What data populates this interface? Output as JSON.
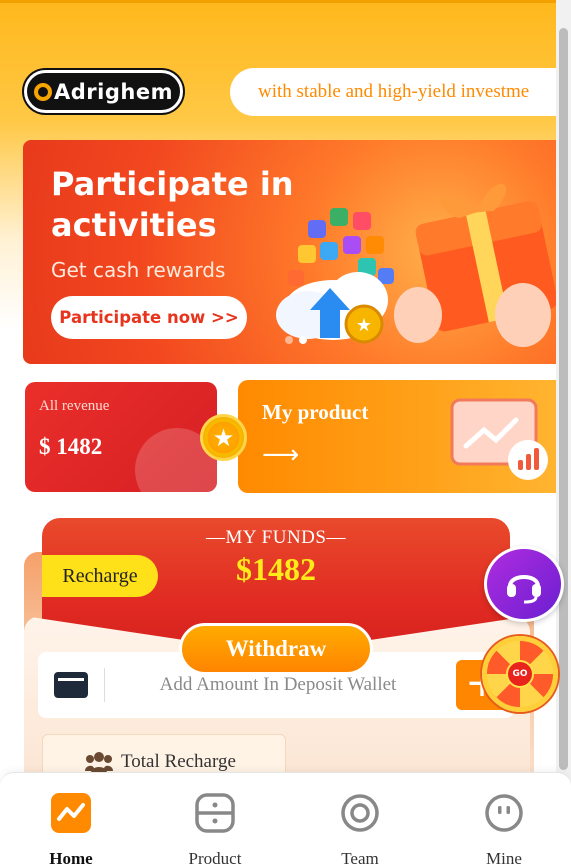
{
  "brand": {
    "logo_text": "Adrighem"
  },
  "marquee": {
    "text": "with stable and high-yield investme"
  },
  "banner": {
    "title": "Participate in activities",
    "subtitle": "Get cash rewards",
    "button_label": "Participate now >>"
  },
  "revenue": {
    "label": "All revenue",
    "value": "$ 1482"
  },
  "my_product": {
    "label": "My product",
    "arrow": "⟶"
  },
  "funds": {
    "label": "—MY FUNDS—",
    "value": "$1482",
    "recharge_label": "Recharge",
    "withdraw_label": "Withdraw",
    "deposit_placeholder": "Add Amount In Deposit Wallet",
    "plus_label": "+",
    "total_recharge_label": "Total Recharge"
  },
  "floating": {
    "wheel_label": "GO"
  },
  "nav": {
    "items": [
      {
        "label": "Home",
        "icon": "home-chart-icon",
        "active": true
      },
      {
        "label": "Product",
        "icon": "product-icon",
        "active": false
      },
      {
        "label": "Team",
        "icon": "team-icon",
        "active": false
      },
      {
        "label": "Mine",
        "icon": "mine-icon",
        "active": false
      }
    ]
  },
  "colors": {
    "accent": "#ff8a00",
    "brand_yellow": "#ffb81c",
    "funds_red": "#e02a22",
    "funds_value": "#ffea1a"
  }
}
